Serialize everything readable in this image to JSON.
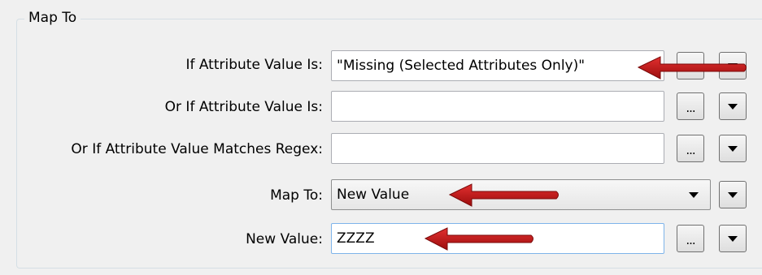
{
  "group": {
    "title": "Map To"
  },
  "rows": [
    {
      "label": "If Attribute Value Is:",
      "value": "\"Missing (Selected Attributes Only)\""
    },
    {
      "label": "Or If Attribute Value Is:",
      "value": ""
    },
    {
      "label": "Or If Attribute Value Matches Regex:",
      "value": ""
    },
    {
      "label": "Map To:",
      "value": "New Value"
    },
    {
      "label": "New Value:",
      "value": "ZZZZ"
    }
  ],
  "buttons": {
    "ellipsis": "..."
  },
  "annotation_color": "#c01818"
}
